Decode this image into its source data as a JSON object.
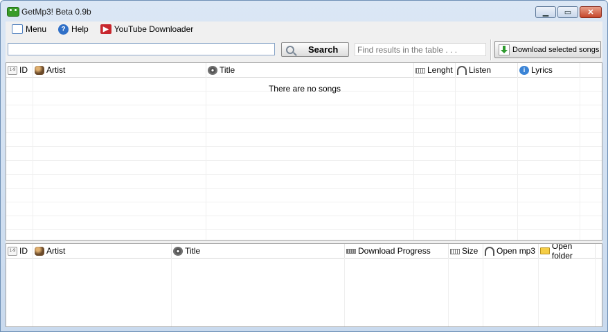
{
  "window": {
    "title": "GetMp3! Beta 0.9b"
  },
  "menu": [
    {
      "label": "Menu",
      "icon": "menu-icon"
    },
    {
      "label": "Help",
      "icon": "help-icon"
    },
    {
      "label": "YouTube Downloader",
      "icon": "youtube-icon"
    }
  ],
  "toolbar": {
    "search_value": "",
    "search_label": "Search",
    "find_placeholder": "Find results in the table . . .",
    "download_selected_label": "Download selected songs"
  },
  "results_table": {
    "columns": [
      "ID",
      "Artist",
      "Title",
      "Lenght",
      "Listen",
      "Lyrics"
    ],
    "empty_message": "There are no songs",
    "rows": []
  },
  "downloads_table": {
    "columns": [
      "ID",
      "Artist",
      "Title",
      "Download Progress",
      "Size",
      "Open mp3",
      "Open folder"
    ],
    "rows": []
  }
}
